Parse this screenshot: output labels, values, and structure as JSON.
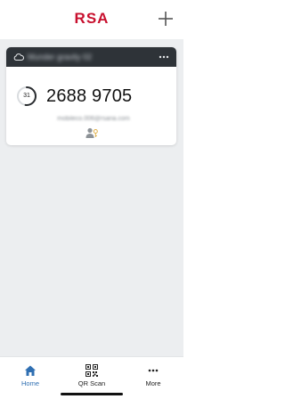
{
  "header": {
    "logo": "RSA",
    "add_icon": "plus-icon"
  },
  "card": {
    "title_blurred": "Munder gravity 02",
    "cloud_icon": "cloud-icon",
    "menu_icon": "kebab-menu-icon",
    "timer_seconds": "31",
    "timer_progress": 0.52,
    "passcode": "2688 9705",
    "account_blurred": "mobileco.006@rsaria.com",
    "user_icon": "user-key-icon"
  },
  "tabs": [
    {
      "label": "Home",
      "icon": "home-icon",
      "active": true
    },
    {
      "label": "QR Scan",
      "icon": "qr-code-icon",
      "active": false
    },
    {
      "label": "More",
      "icon": "more-dots-icon",
      "active": false
    }
  ],
  "colors": {
    "brand": "#c8102e",
    "card_header": "#2e3338",
    "active_tab": "#2f6fb2",
    "background": "#eceef0"
  }
}
